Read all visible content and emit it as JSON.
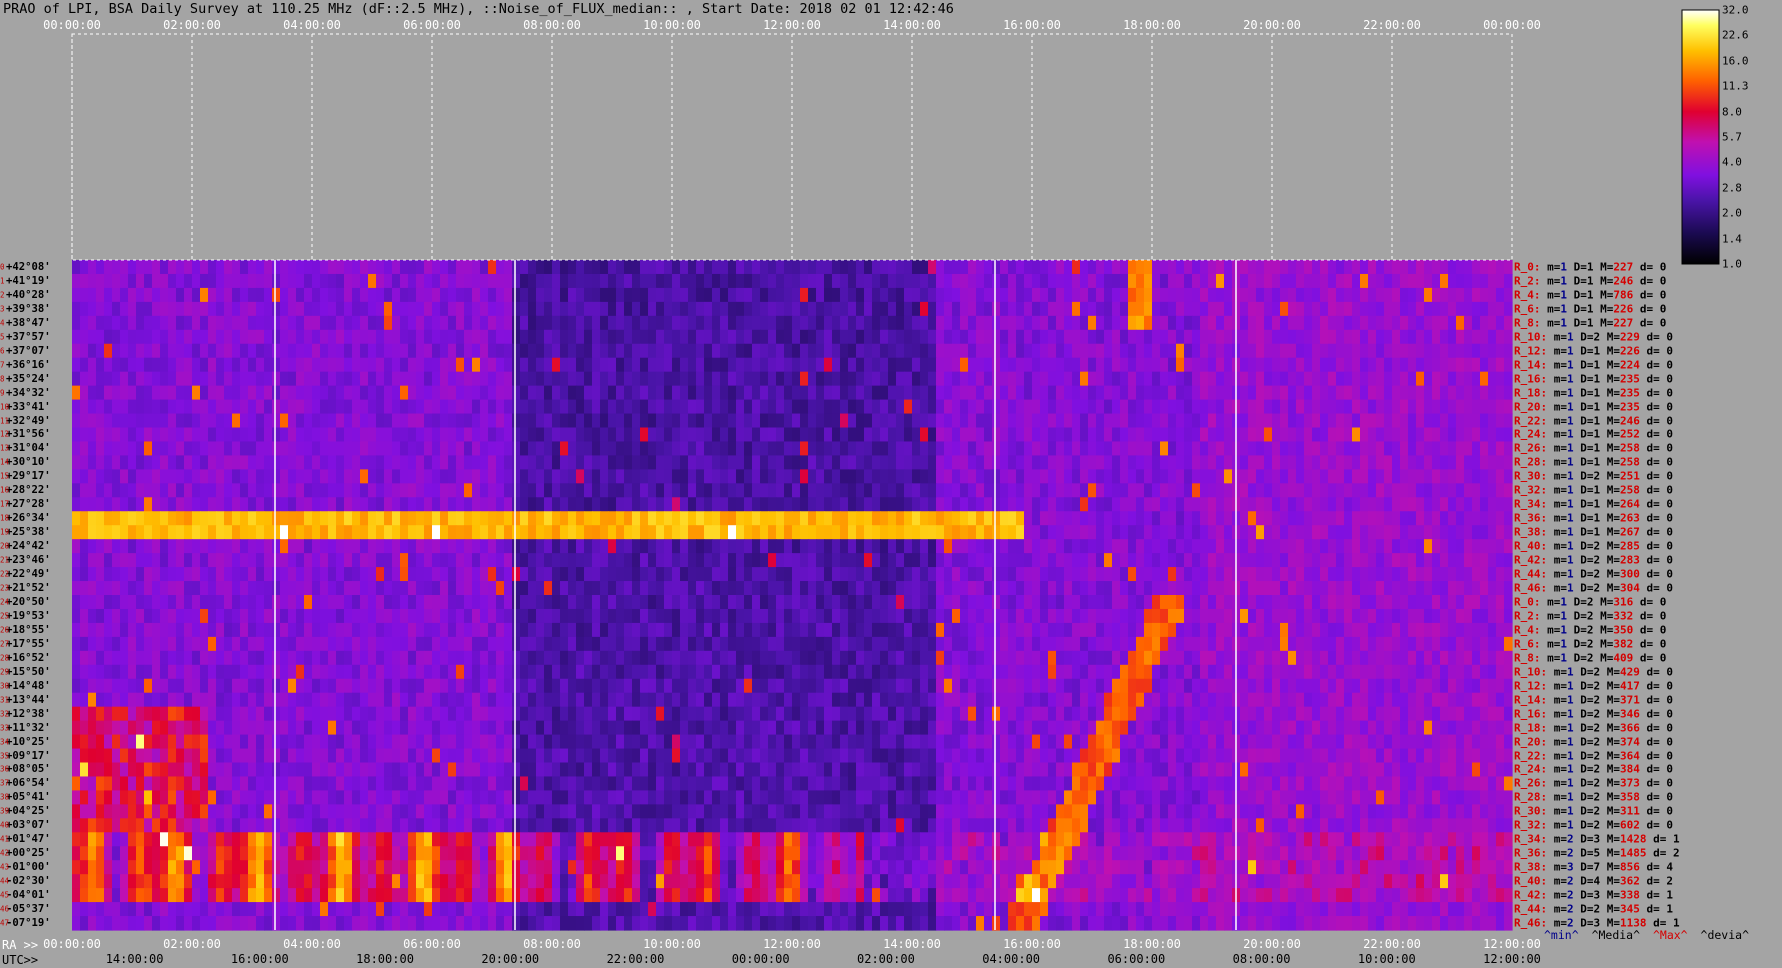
{
  "title": "PRAO of LPI, BSA Daily Survey at 110.25 MHz (dF::2.5 MHz), ::Noise_of_FLUX_median:: , Start Date: 2018 02 01 12:42:46",
  "row_labels": {
    "ra": "RA >>",
    "utc": "UTC>>"
  },
  "legend": {
    "min": "^min^",
    "median": "^Media^",
    "max": "^Max^",
    "devia": "^devia^"
  },
  "colors": {
    "background": "#a4a4a4",
    "label_red": "#d40000",
    "label_blue": "#00008a",
    "guide_line": "#ffffff"
  },
  "chart_data": {
    "type": "heatmap",
    "title": "PRAO of LPI, BSA Daily Survey at 110.25 MHz (dF::2.5 MHz), ::Noise_of_FLUX_median:: , Start Date: 2018 02 01 12:42:46",
    "x_top_ticks": [
      "00:00:00",
      "02:00:00",
      "04:00:00",
      "06:00:00",
      "08:00:00",
      "10:00:00",
      "12:00:00",
      "14:00:00",
      "16:00:00",
      "18:00:00",
      "20:00:00",
      "22:00:00",
      "00:00:00"
    ],
    "x_ra_ticks": [
      "00:00:00",
      "02:00:00",
      "04:00:00",
      "06:00:00",
      "08:00:00",
      "10:00:00",
      "12:00:00",
      "14:00:00",
      "16:00:00",
      "18:00:00",
      "20:00:00",
      "22:00:00",
      "12:00:00"
    ],
    "x_utc_ticks": [
      "14:00:00",
      "16:00:00",
      "18:00:00",
      "20:00:00",
      "22:00:00",
      "00:00:00",
      "02:00:00",
      "04:00:00",
      "06:00:00",
      "08:00:00",
      "10:00:00",
      "12:00:00"
    ],
    "y_declinations": [
      "+42°08'",
      "+41°19'",
      "+40°28'",
      "+39°38'",
      "+38°47'",
      "+37°57'",
      "+37°07'",
      "+36°16'",
      "+35°24'",
      "+34°32'",
      "+33°41'",
      "+32°49'",
      "+31°56'",
      "+31°04'",
      "+30°10'",
      "+29°17'",
      "+28°22'",
      "+27°28'",
      "+26°34'",
      "+25°38'",
      "+24°42'",
      "+23°46'",
      "+22°49'",
      "+21°52'",
      "+20°50'",
      "+19°53'",
      "+18°55'",
      "+17°55'",
      "+16°52'",
      "+15°50'",
      "+14°48'",
      "+13°44'",
      "+12°38'",
      "+11°32'",
      "+10°25'",
      "+09°17'",
      "+08°05'",
      "+06°54'",
      "+05°41'",
      "+04°25'",
      "+03°07'",
      "+01°47'",
      "+00°25'",
      "-01°00'",
      "-02°30'",
      "-04°01'",
      "-05°37'",
      "-07°19'"
    ],
    "y_row_index": [
      "0",
      "1",
      "2",
      "3",
      "4",
      "5",
      "6",
      "7",
      "8",
      "9",
      "10",
      "11",
      "12",
      "13",
      "14",
      "15",
      "16",
      "17",
      "18",
      "19",
      "20",
      "21",
      "22",
      "23",
      "24",
      "25",
      "26",
      "27",
      "28",
      "29",
      "30",
      "31",
      "32",
      "33",
      "34",
      "35",
      "36",
      "37",
      "38",
      "39",
      "40",
      "41",
      "42",
      "43",
      "44",
      "45",
      "46",
      "47"
    ],
    "colorbar": {
      "ticks": [
        "32.0",
        "22.6",
        "16.0",
        "11.3",
        "8.0",
        "5.7",
        "4.0",
        "2.8",
        "2.0",
        "1.4",
        "1.0"
      ],
      "min": 1.0,
      "max": 32.0,
      "scale": "log"
    },
    "row_stats": [
      {
        "r": "R_0:",
        "m": "1",
        "d": "1",
        "max": "227",
        "dev": "0"
      },
      {
        "r": "R_2:",
        "m": "1",
        "d": "1",
        "max": "246",
        "dev": "0"
      },
      {
        "r": "R_4:",
        "m": "1",
        "d": "1",
        "max": "786",
        "dev": "0"
      },
      {
        "r": "R_6:",
        "m": "1",
        "d": "1",
        "max": "226",
        "dev": "0"
      },
      {
        "r": "R_8:",
        "m": "1",
        "d": "1",
        "max": "227",
        "dev": "0"
      },
      {
        "r": "R_10:",
        "m": "1",
        "d": "2",
        "max": "229",
        "dev": "0"
      },
      {
        "r": "R_12:",
        "m": "1",
        "d": "1",
        "max": "226",
        "dev": "0"
      },
      {
        "r": "R_14:",
        "m": "1",
        "d": "1",
        "max": "224",
        "dev": "0"
      },
      {
        "r": "R_16:",
        "m": "1",
        "d": "1",
        "max": "235",
        "dev": "0"
      },
      {
        "r": "R_18:",
        "m": "1",
        "d": "1",
        "max": "235",
        "dev": "0"
      },
      {
        "r": "R_20:",
        "m": "1",
        "d": "1",
        "max": "235",
        "dev": "0"
      },
      {
        "r": "R_22:",
        "m": "1",
        "d": "1",
        "max": "246",
        "dev": "0"
      },
      {
        "r": "R_24:",
        "m": "1",
        "d": "1",
        "max": "252",
        "dev": "0"
      },
      {
        "r": "R_26:",
        "m": "1",
        "d": "1",
        "max": "258",
        "dev": "0"
      },
      {
        "r": "R_28:",
        "m": "1",
        "d": "1",
        "max": "258",
        "dev": "0"
      },
      {
        "r": "R_30:",
        "m": "1",
        "d": "2",
        "max": "251",
        "dev": "0"
      },
      {
        "r": "R_32:",
        "m": "1",
        "d": "1",
        "max": "258",
        "dev": "0"
      },
      {
        "r": "R_34:",
        "m": "1",
        "d": "1",
        "max": "264",
        "dev": "0"
      },
      {
        "r": "R_36:",
        "m": "1",
        "d": "1",
        "max": "263",
        "dev": "0"
      },
      {
        "r": "R_38:",
        "m": "1",
        "d": "1",
        "max": "267",
        "dev": "0"
      },
      {
        "r": "R_40:",
        "m": "1",
        "d": "2",
        "max": "285",
        "dev": "0"
      },
      {
        "r": "R_42:",
        "m": "1",
        "d": "2",
        "max": "283",
        "dev": "0"
      },
      {
        "r": "R_44:",
        "m": "1",
        "d": "2",
        "max": "300",
        "dev": "0"
      },
      {
        "r": "R_46:",
        "m": "1",
        "d": "2",
        "max": "304",
        "dev": "0"
      },
      {
        "r": "R_0:",
        "m": "1",
        "d": "2",
        "max": "316",
        "dev": "0"
      },
      {
        "r": "R_2:",
        "m": "1",
        "d": "2",
        "max": "332",
        "dev": "0"
      },
      {
        "r": "R_4:",
        "m": "1",
        "d": "2",
        "max": "350",
        "dev": "0"
      },
      {
        "r": "R_6:",
        "m": "1",
        "d": "2",
        "max": "382",
        "dev": "0"
      },
      {
        "r": "R_8:",
        "m": "1",
        "d": "2",
        "max": "409",
        "dev": "0"
      },
      {
        "r": "R_10:",
        "m": "1",
        "d": "2",
        "max": "429",
        "dev": "0"
      },
      {
        "r": "R_12:",
        "m": "1",
        "d": "2",
        "max": "417",
        "dev": "0"
      },
      {
        "r": "R_14:",
        "m": "1",
        "d": "2",
        "max": "371",
        "dev": "0"
      },
      {
        "r": "R_16:",
        "m": "1",
        "d": "2",
        "max": "346",
        "dev": "0"
      },
      {
        "r": "R_18:",
        "m": "1",
        "d": "2",
        "max": "366",
        "dev": "0"
      },
      {
        "r": "R_20:",
        "m": "1",
        "d": "2",
        "max": "374",
        "dev": "0"
      },
      {
        "r": "R_22:",
        "m": "1",
        "d": "2",
        "max": "364",
        "dev": "0"
      },
      {
        "r": "R_24:",
        "m": "1",
        "d": "2",
        "max": "384",
        "dev": "0"
      },
      {
        "r": "R_26:",
        "m": "1",
        "d": "2",
        "max": "373",
        "dev": "0"
      },
      {
        "r": "R_28:",
        "m": "1",
        "d": "2",
        "max": "358",
        "dev": "0"
      },
      {
        "r": "R_30:",
        "m": "1",
        "d": "2",
        "max": "311",
        "dev": "0"
      },
      {
        "r": "R_32:",
        "m": "1",
        "d": "2",
        "max": "602",
        "dev": "0"
      },
      {
        "r": "R_34:",
        "m": "2",
        "d": "3",
        "max": "1428",
        "dev": "1"
      },
      {
        "r": "R_36:",
        "m": "2",
        "d": "5",
        "max": "1485",
        "dev": "2"
      },
      {
        "r": "R_38:",
        "m": "3",
        "d": "7",
        "max": "856",
        "dev": "4"
      },
      {
        "r": "R_40:",
        "m": "2",
        "d": "4",
        "max": "362",
        "dev": "2"
      },
      {
        "r": "R_42:",
        "m": "2",
        "d": "3",
        "max": "338",
        "dev": "1"
      },
      {
        "r": "R_44:",
        "m": "2",
        "d": "2",
        "max": "345",
        "dev": "1"
      },
      {
        "r": "R_46:",
        "m": "2",
        "d": "3",
        "max": "1138",
        "dev": "1"
      }
    ]
  }
}
